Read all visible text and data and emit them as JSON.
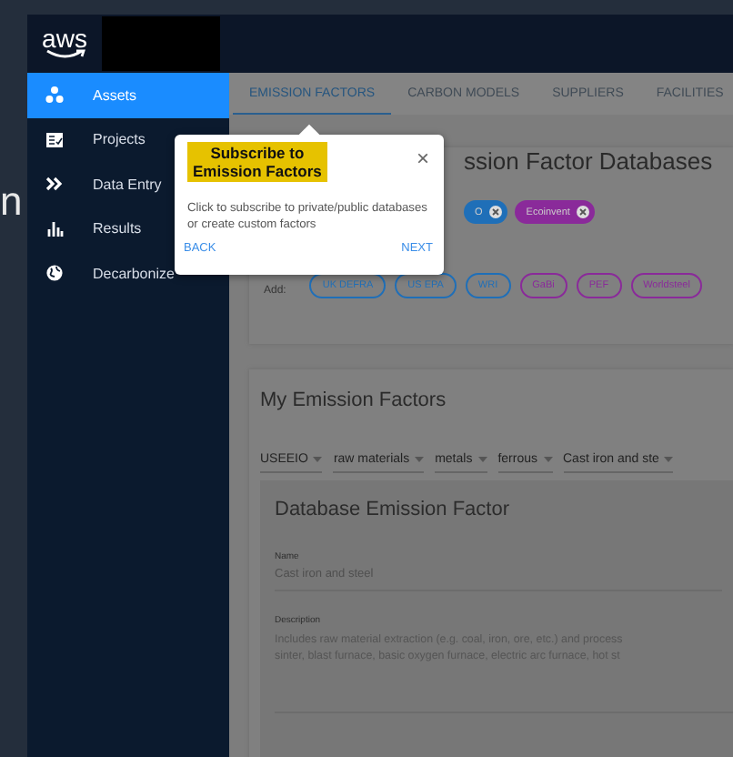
{
  "backdrop_text": "n",
  "header": {
    "logo": "aws"
  },
  "sidebar": {
    "items": [
      {
        "label": "Assets",
        "selected": true
      },
      {
        "label": "Projects",
        "selected": false
      },
      {
        "label": "Data Entry",
        "selected": false
      },
      {
        "label": "Results",
        "selected": false
      },
      {
        "label": "Decarbonize",
        "selected": false
      }
    ]
  },
  "tabs": [
    {
      "label": "EMISSION FACTORS",
      "selected": true
    },
    {
      "label": "CARBON MODELS",
      "selected": false
    },
    {
      "label": "SUPPLIERS",
      "selected": false
    },
    {
      "label": "FACILITIES",
      "selected": false
    }
  ],
  "databases_card": {
    "title": "ssion Factor Databases",
    "subscribed": [
      {
        "label": "O",
        "color": "#1f6fb8"
      },
      {
        "label": "Ecoinvent",
        "color": "#8a2a9a"
      }
    ],
    "add_label": "Add:",
    "available": [
      {
        "label": "UK DEFRA",
        "color": "#1f6fb8"
      },
      {
        "label": "US EPA",
        "color": "#1f6fb8"
      },
      {
        "label": "WRI",
        "color": "#1f6fb8"
      },
      {
        "label": "GaBi",
        "color": "#8a2a9a"
      },
      {
        "label": "PEF",
        "color": "#8a2a9a"
      },
      {
        "label": "Worldsteel",
        "color": "#8a2a9a"
      }
    ]
  },
  "my_factors": {
    "title": "My Emission Factors",
    "filters": [
      "USEEIO",
      "raw materials",
      "metals",
      "ferrous",
      "Cast iron and ste"
    ],
    "detail": {
      "title": "Database Emission Factor",
      "name_label": "Name",
      "name_value": "Cast iron and steel",
      "description_label": "Description",
      "description_lines": [
        "Includes raw material extraction (e.g. coal, iron, ore, etc.) and process",
        "sinter, blast furnace, basic oxygen furnace, electric arc furnace, hot st"
      ]
    }
  },
  "popover": {
    "title_lines": [
      "Subscribe to",
      "Emission Factors"
    ],
    "body": "Click to subscribe to private/public databases or create custom factors",
    "close": "×",
    "back": "BACK",
    "next": "NEXT"
  }
}
